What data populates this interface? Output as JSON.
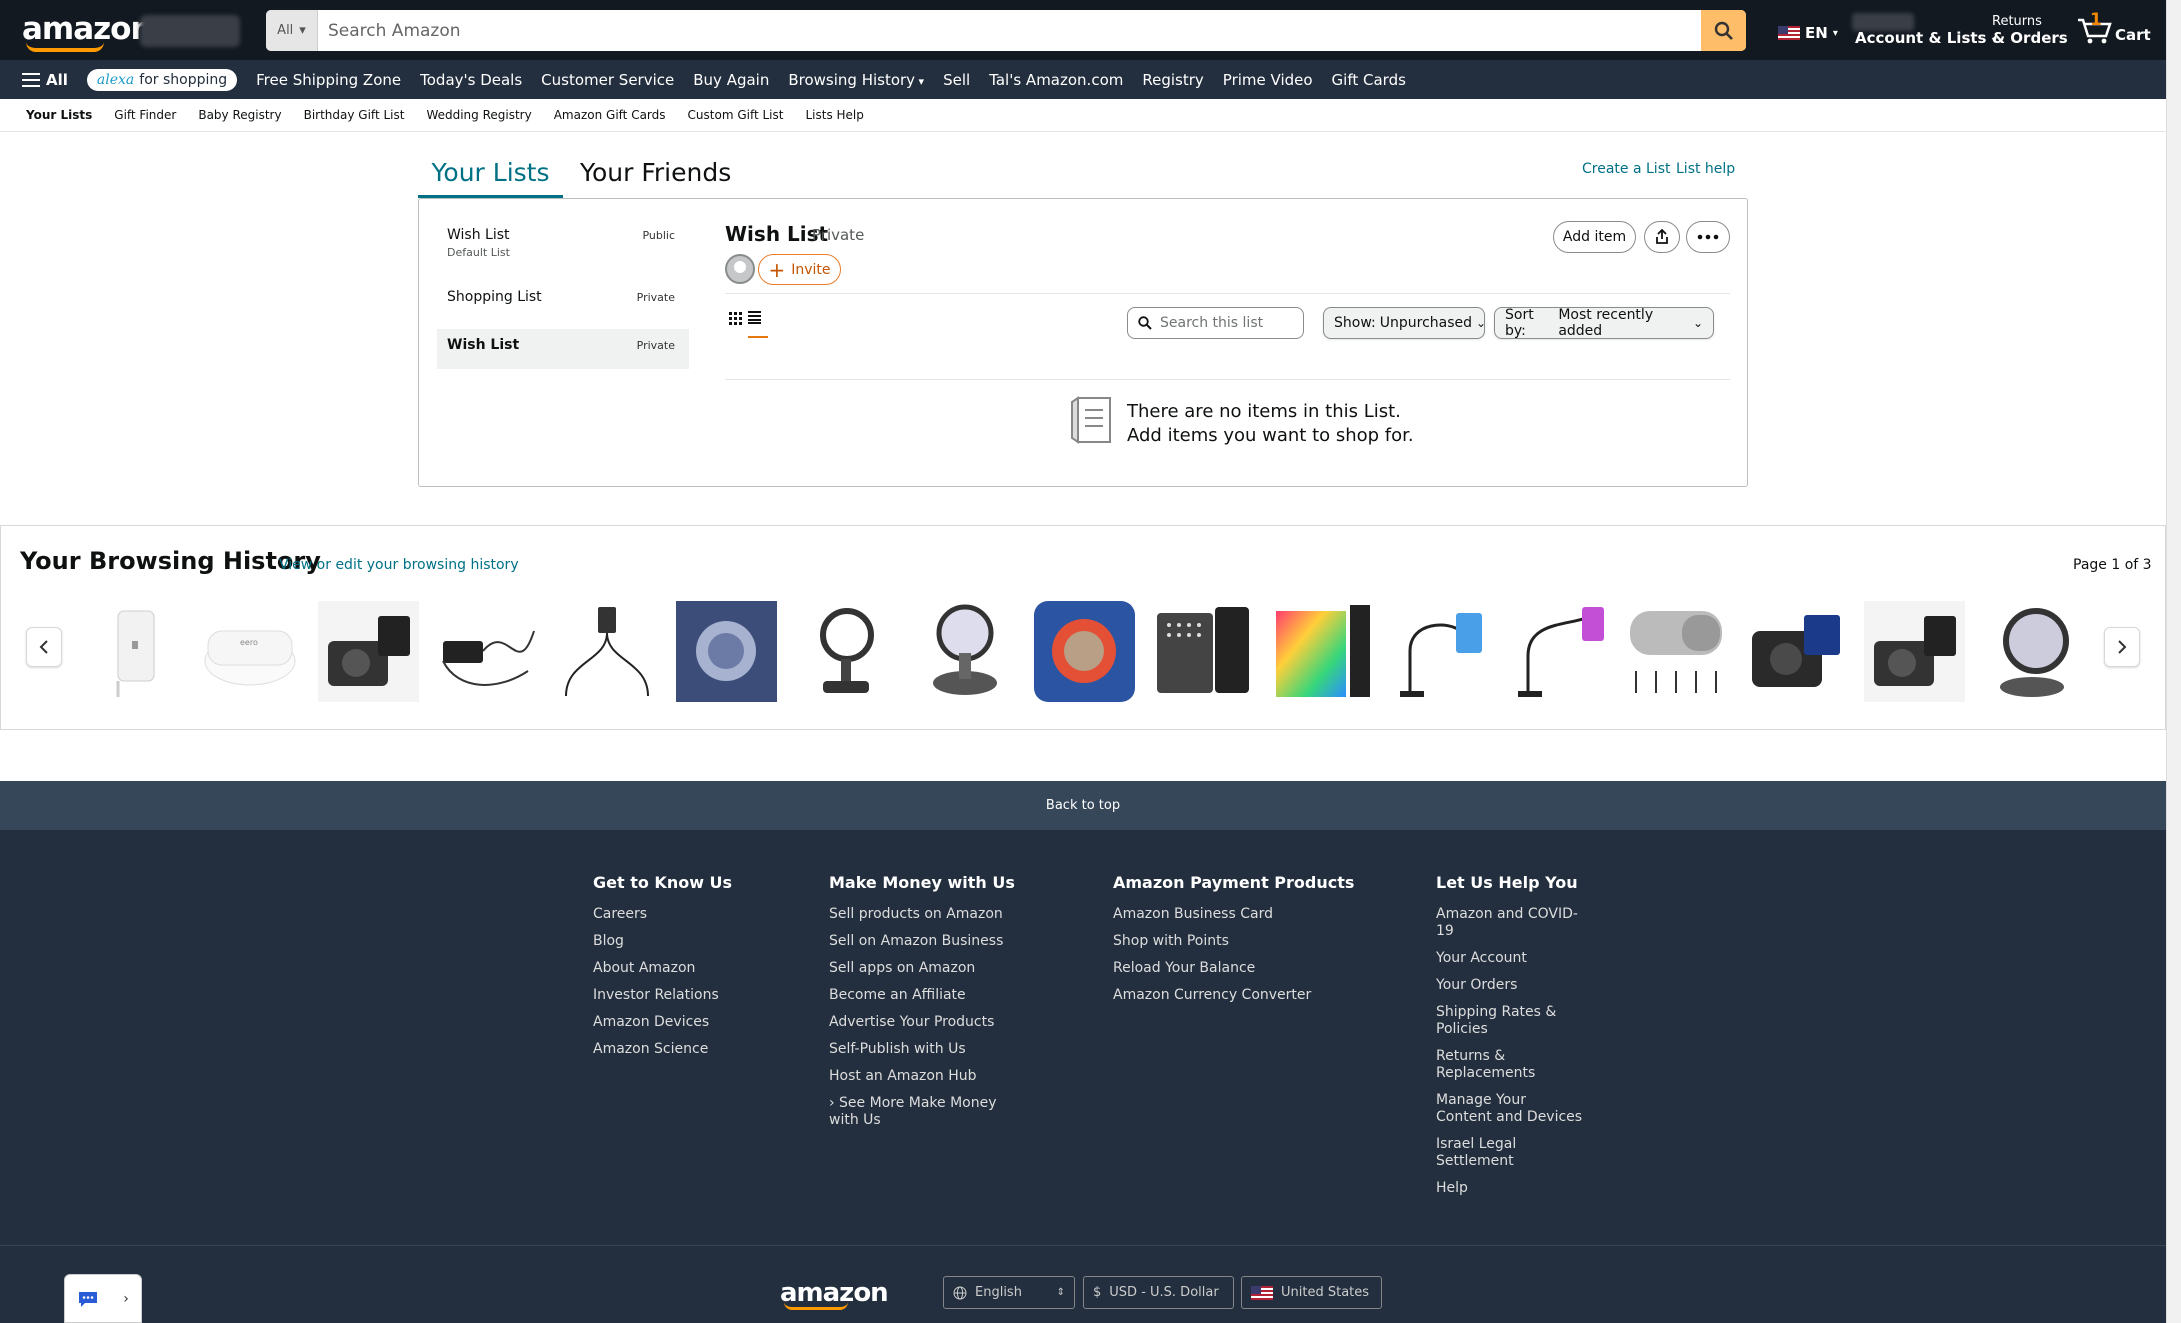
{
  "header": {
    "logo": "amazon",
    "search_category": "All",
    "search_placeholder": "Search Amazon",
    "language": "EN",
    "account_label": "Account & Lists",
    "returns_line1": "Returns",
    "returns_line2": "& Orders",
    "cart_count": "1",
    "cart_label": "Cart"
  },
  "subnav": {
    "all_label": "All",
    "alexa_brand": "alexa",
    "alexa_suffix": "for shopping",
    "items": [
      "Free Shipping Zone",
      "Today's Deals",
      "Customer Service",
      "Buy Again",
      "Browsing History",
      "Sell",
      "Tal's Amazon.com",
      "Registry",
      "Prime Video",
      "Gift Cards"
    ]
  },
  "listnav": {
    "items": [
      "Your Lists",
      "Gift Finder",
      "Baby Registry",
      "Birthday Gift List",
      "Wedding Registry",
      "Amazon Gift Cards",
      "Custom Gift List",
      "Lists Help"
    ]
  },
  "tabs": {
    "your_lists": "Your Lists",
    "your_friends": "Your Friends"
  },
  "links": {
    "create_list": "Create a List",
    "list_help": "List help"
  },
  "lists": [
    {
      "name": "Wish List",
      "sub": "Default List",
      "visibility": "Public"
    },
    {
      "name": "Shopping List",
      "sub": "",
      "visibility": "Private"
    },
    {
      "name": "Wish List",
      "sub": "",
      "visibility": "Private"
    }
  ],
  "list_detail": {
    "title": "Wish List",
    "privacy": "Private",
    "invite": "Invite",
    "add_item": "Add item",
    "search_placeholder": "Search this list",
    "show_label": "Show:",
    "show_value": "Unpurchased",
    "sort_label": "Sort by:",
    "sort_value": "Most recently added",
    "empty_line1": "There are no items in this List.",
    "empty_line2": "Add items you want to shop for."
  },
  "browsing_history": {
    "title": "Your Browsing History",
    "edit_link": "View or edit your browsing history",
    "page": "Page 1 of 3"
  },
  "back_to_top": "Back to top",
  "footer": {
    "columns": [
      {
        "title": "Get to Know Us",
        "links": [
          "Careers",
          "Blog",
          "About Amazon",
          "Investor Relations",
          "Amazon Devices",
          "Amazon Science"
        ]
      },
      {
        "title": "Make Money with Us",
        "links": [
          "Sell products on Amazon",
          "Sell on Amazon Business",
          "Sell apps on Amazon",
          "Become an Affiliate",
          "Advertise Your Products",
          "Self-Publish with Us",
          "Host an Amazon Hub",
          "› See More Make Money\nwith Us"
        ]
      },
      {
        "title": "Amazon Payment Products",
        "links": [
          "Amazon Business Card",
          "Shop with Points",
          "Reload Your Balance",
          "Amazon Currency Converter"
        ]
      },
      {
        "title": "Let Us Help You",
        "links": [
          "Amazon and COVID-\n19",
          "Your Account",
          "Your Orders",
          "Shipping Rates &\nPolicies",
          "Returns &\nReplacements",
          "Manage Your\nContent and Devices",
          "Israel Legal\nSettlement",
          "Help"
        ]
      }
    ],
    "logo": "amazon",
    "language": "English",
    "currency": "USD - U.S. Dollar",
    "currency_symbol": "$",
    "country": "United States"
  },
  "colors": {
    "nav_dark": "#131921",
    "nav_mid": "#232f3e",
    "accent": "#ff9900",
    "link": "#007185",
    "search_btn": "#febd69"
  }
}
